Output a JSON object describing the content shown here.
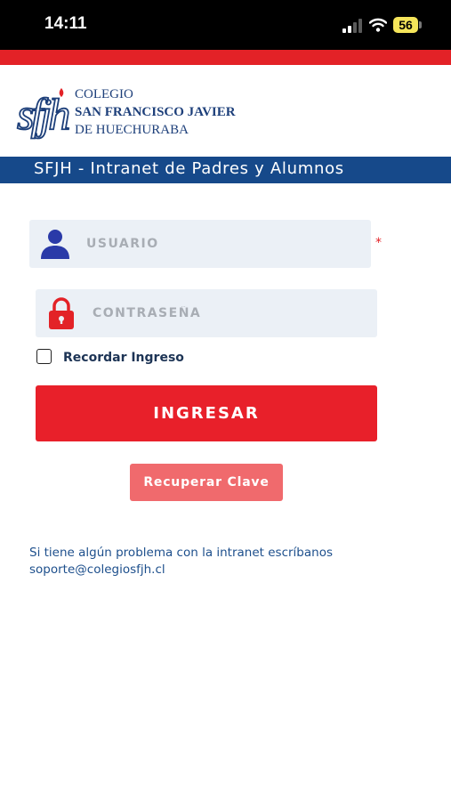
{
  "status_bar": {
    "time": "14:11",
    "battery": "56",
    "icons": [
      "cellular-signal-icon",
      "wifi-icon",
      "battery-icon"
    ]
  },
  "header": {
    "logo_monogram": "sfjh",
    "school_line1": "COLEGIO",
    "school_line2": "SAN FRANCISCO JAVIER",
    "school_line3": "DE HUECHURABA",
    "portal_title": "SFJH - Intranet de Padres y Alumnos"
  },
  "login_form": {
    "username": {
      "icon": "user-icon",
      "placeholder": "USUARIO",
      "value": "",
      "required_mark": "*"
    },
    "password": {
      "icon": "lock-icon",
      "placeholder": "CONTRASEÑA",
      "value": ""
    },
    "remember_label": "Recordar Ingreso",
    "remember_checked": false,
    "submit_label": "INGRESAR",
    "recover_label": "Recuperar Clave"
  },
  "support": {
    "message": "Si tiene algún problema con la intranet escríbanos",
    "email": "soporte@colegiosfjh.cl"
  },
  "colors": {
    "brand_blue": "#16498a",
    "brand_red": "#e32227",
    "primary_button": "#e8202a",
    "secondary_button": "#f06a6d",
    "field_background": "#ebf0f6",
    "support_text": "#1d4f8c"
  }
}
